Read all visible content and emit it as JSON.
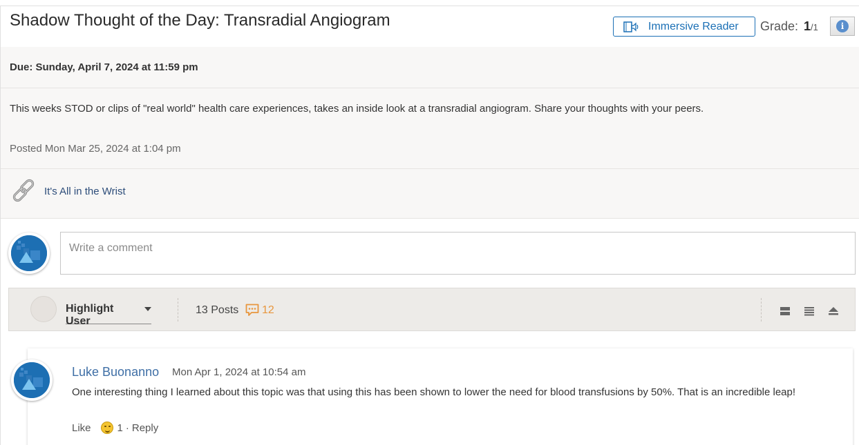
{
  "header": {
    "title": "Shadow Thought of the Day: Transradial Angiogram",
    "immersive_reader_label": "Immersive Reader",
    "grade_label": "Grade:",
    "grade_value": "1",
    "grade_total": "/1"
  },
  "topic": {
    "due": "Due: Sunday, April 7, 2024 at 11:59 pm",
    "description": "This weeks STOD or clips of \"real world\" health care experiences, takes an inside look at a transradial angiogram. Share your thoughts with your peers.",
    "posted": "Posted Mon Mar 25, 2024 at 1:04 pm",
    "link_label": "It's All in the Wrist"
  },
  "comment": {
    "placeholder": "Write a comment"
  },
  "toolbar": {
    "highlight_user_label": "Highlight User",
    "posts_count": "13 Posts",
    "replies_count": "12"
  },
  "posts": [
    {
      "author": "Luke Buonanno",
      "date": "Mon Apr 1, 2024 at 10:54 am",
      "body": "One interesting thing I learned about this topic was that using this has been shown to lower the need for blood transfusions by 50%. That is an incredible leap!",
      "like_label": "Like",
      "like_count": "1",
      "separator": "·",
      "reply_label": "Reply"
    }
  ],
  "colors": {
    "accent": "#1a6fb5",
    "author_link": "#3f6fa6",
    "reply_count": "#e8963d",
    "avatar": "#1d6fb3"
  },
  "icons": {
    "immersive_reader": "reader-speaker-icon",
    "info": "info-icon",
    "link": "chain-link-icon",
    "replies": "speech-bubble-icon",
    "view_modes": [
      "expand-view-icon",
      "list-view-icon",
      "collapse-view-icon"
    ]
  }
}
